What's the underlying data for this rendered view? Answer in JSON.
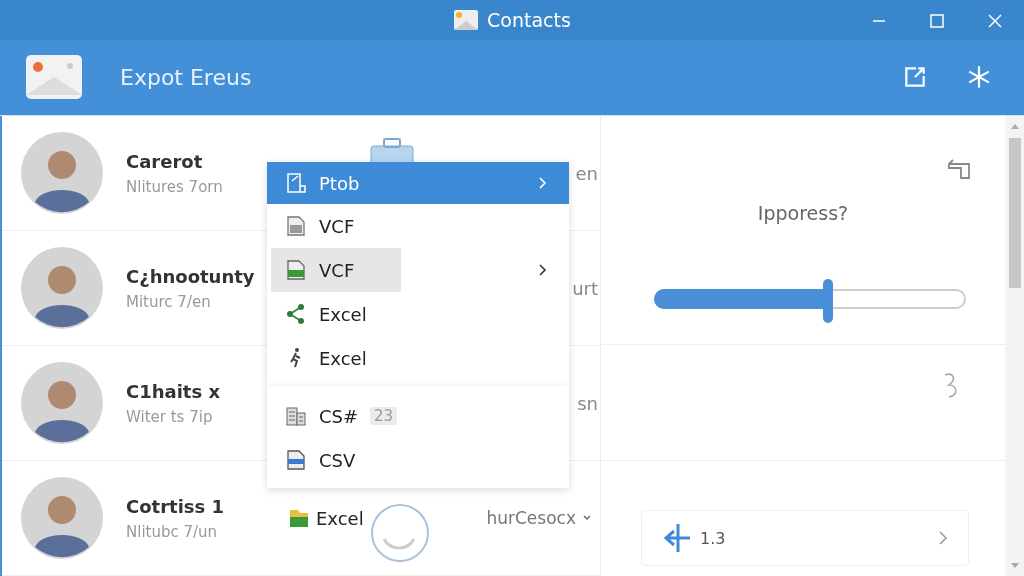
{
  "window": {
    "title": "Contacts"
  },
  "header": {
    "title": "Expot Ereus"
  },
  "contacts": [
    {
      "name": "Carerot",
      "subtitle": "Nlitures 7orn",
      "trailing": "en",
      "kind": "plain"
    },
    {
      "name": "C¿hnootunty",
      "subtitle": "Miturc 7/en",
      "trailing": "urt",
      "kind": "plain"
    },
    {
      "name": "C1haits x",
      "subtitle": "Witer ts 7ip",
      "trailing": "sn",
      "kind": "plain"
    },
    {
      "name": "Cotrtiss 1",
      "subtitle": "Nlitubc 7/un",
      "kind": "format",
      "format": "Excel",
      "dropdown": "hurCesocx"
    }
  ],
  "menu": {
    "sections": [
      [
        {
          "label": "Ptob",
          "kind": "edit",
          "selected": true,
          "hovered": false,
          "submenu": true
        },
        {
          "label": "VCF",
          "kind": "sheet-grey",
          "selected": false,
          "hovered": false,
          "submenu": false
        },
        {
          "label": "VCF",
          "kind": "sheet-green",
          "selected": false,
          "hovered": true,
          "submenu": true
        },
        {
          "label": "Excel",
          "kind": "share",
          "selected": false,
          "hovered": false,
          "submenu": false
        },
        {
          "label": "Excel",
          "kind": "runner",
          "selected": false,
          "hovered": false,
          "submenu": false
        }
      ],
      [
        {
          "label": "CS#",
          "note": "23",
          "kind": "building",
          "selected": false,
          "hovered": false,
          "submenu": false
        },
        {
          "label": "CSV",
          "kind": "sheet-blue",
          "selected": false,
          "hovered": false,
          "submenu": false
        }
      ]
    ]
  },
  "panel": {
    "label": "Ipporess?",
    "slider": {
      "level": 0.56
    },
    "stepper": {
      "value": "1.3"
    }
  }
}
